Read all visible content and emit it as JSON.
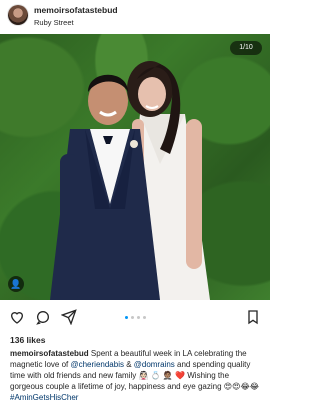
{
  "header": {
    "username": "memoirsofatastebud",
    "location": "Ruby Street"
  },
  "photo": {
    "counter": "1/10",
    "tag_icon": "person-tag-icon"
  },
  "actions": {
    "like_icon": "heart-icon",
    "comment_icon": "comment-bubble-icon",
    "share_icon": "paper-plane-icon",
    "save_icon": "bookmark-icon",
    "carousel_active_index": 1,
    "carousel_dots": 4
  },
  "likes": "136 likes",
  "caption": {
    "username": "memoirsofatastebud",
    "text_1": "Spent a beautiful week in LA celebrating the magnetic love of ",
    "mention_1": "@cheriendabis",
    "text_2": " & ",
    "mention_2": "@domrains",
    "text_3": " and spending quality time with old friends and new family 👰🏻 💍 🤵🏽 ❤️ Wishing the gorgeous couple a lifetime of joy, happiness and eye gazing 😍😍😂😂 ",
    "hashtag": "#AminGetsHisCher"
  },
  "colors": {
    "accent": "#0095f6",
    "link": "#00376b"
  }
}
